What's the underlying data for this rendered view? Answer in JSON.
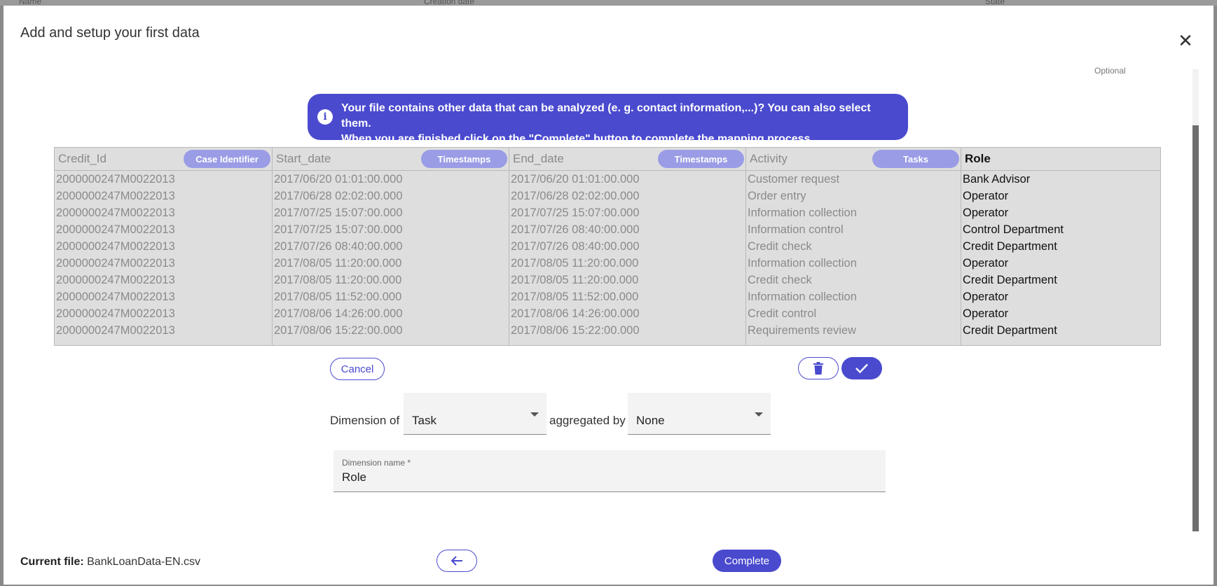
{
  "background": {
    "columns": [
      "Name",
      "Creation date",
      "State"
    ]
  },
  "modal": {
    "title": "Add and setup your first data",
    "optional_label": "Optional"
  },
  "banner": {
    "line1": "Your file contains other data that can be analyzed (e. g. contact information,...)? You can also select them.",
    "line2": "When you are finished click on the \"Complete\" button to complete the mapping process."
  },
  "table": {
    "columns": [
      {
        "header": "Credit_Id",
        "tag": "Case Identifier"
      },
      {
        "header": "Start_date",
        "tag": "Timestamps"
      },
      {
        "header": "End_date",
        "tag": "Timestamps"
      },
      {
        "header": "Activity",
        "tag": "Tasks"
      },
      {
        "header": "Role",
        "tag": ""
      }
    ],
    "rows": [
      [
        "2000000247M0022013",
        "2017/06/20 01:01:00.000",
        "2017/06/20 01:01:00.000",
        "Customer request",
        "Bank Advisor"
      ],
      [
        "2000000247M0022013",
        "2017/06/28 02:02:00.000",
        "2017/06/28 02:02:00.000",
        "Order entry",
        "Operator"
      ],
      [
        "2000000247M0022013",
        "2017/07/25 15:07:00.000",
        "2017/07/25 15:07:00.000",
        "Information collection",
        "Operator"
      ],
      [
        "2000000247M0022013",
        "2017/07/25 15:07:00.000",
        "2017/07/26 08:40:00.000",
        "Information control",
        "Control Department"
      ],
      [
        "2000000247M0022013",
        "2017/07/26 08:40:00.000",
        "2017/07/26 08:40:00.000",
        "Credit check",
        "Credit Department"
      ],
      [
        "2000000247M0022013",
        "2017/08/05 11:20:00.000",
        "2017/08/05 11:20:00.000",
        "Information collection",
        "Operator"
      ],
      [
        "2000000247M0022013",
        "2017/08/05 11:20:00.000",
        "2017/08/05 11:20:00.000",
        "Credit check",
        "Credit Department"
      ],
      [
        "2000000247M0022013",
        "2017/08/05 11:52:00.000",
        "2017/08/05 11:52:00.000",
        "Information collection",
        "Operator"
      ],
      [
        "2000000247M0022013",
        "2017/08/06 14:26:00.000",
        "2017/08/06 14:26:00.000",
        "Credit control",
        "Operator"
      ],
      [
        "2000000247M0022013",
        "2017/08/06 15:22:00.000",
        "2017/08/06 15:22:00.000",
        "Requirements review",
        "Credit Department"
      ]
    ]
  },
  "actions": {
    "cancel_label": "Cancel",
    "delete_icon": "trash-icon",
    "confirm_icon": "check-icon"
  },
  "dimension": {
    "label_prefix": "Dimension of",
    "type_value": "Task",
    "aggregated_label": "aggregated by",
    "aggregation_value": "None",
    "name_label": "Dimension name *",
    "name_value": "Role"
  },
  "footer": {
    "current_file_label": "Current file:",
    "current_file_name": "BankLoanData-EN.csv",
    "back_icon": "arrow-left-icon",
    "complete_label": "Complete"
  },
  "colors": {
    "accent": "#4a4acf",
    "tag_pill": "#9a9ce6",
    "table_bg": "#dedede"
  }
}
